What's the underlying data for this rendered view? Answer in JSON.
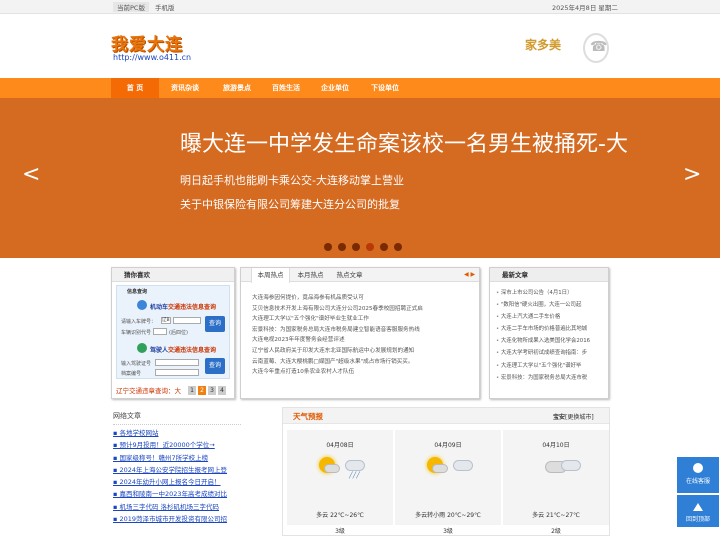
{
  "topbar": {
    "pc_label": "当前PC版",
    "mobile_label": "手机版",
    "date": "2025年4月8日 星期二"
  },
  "header": {
    "logo": "我爱大连",
    "url": "http://www.o411.cn",
    "brand": "家多美"
  },
  "nav": {
    "items": [
      "首 页",
      "资讯杂谈",
      "旅游景点",
      "百姓生活",
      "企业单位",
      "下设单位"
    ],
    "active_index": 0
  },
  "banner": {
    "headline": "曝大连一中学发生命案该校一名男生被捅死-大",
    "sub1": "明日起手机也能刷卡乘公交-大连移动掌上营业",
    "sub2": "关于中银保险有限公司筹建大连分公司的批复",
    "prev": "<",
    "next": ">",
    "dot_count": 6,
    "active_dot": 3
  },
  "traffic": {
    "title": "猜你喜欢",
    "info_label": "信息查询",
    "vehicle_title_a": "机动车",
    "vehicle_title_b": "交通违法信息查询",
    "plate_label": "请输入车牌号：",
    "plate_prefix": "辽B",
    "engine_label": "车辆识别代号",
    "engine_hint": "(后四位)",
    "query": "查询",
    "driver_title_a": "驾驶人",
    "driver_title_b": "交通违法信息查询",
    "license_label": "输入驾驶证号",
    "file_label": "档案编号",
    "footer_text": "辽宁交通违章查询：大",
    "pages": [
      "1",
      "2",
      "3",
      "4"
    ],
    "active_page": 1
  },
  "news": {
    "tabs": [
      "本周热点",
      "本月热点",
      "热点文章"
    ],
    "active_tab": 0,
    "arrows": "◀ ▶",
    "items": [
      "大连海参因何提价，竟品海参有机品质受认可",
      "艾贝信息技术开发上海有限公司大连分公司2025春季校园招聘正式启",
      "大连理工大学以\"五个强化\"谱好毕业生就业工作",
      "宏景科技：为国家税务总局大连市税务局建立智能语音客服服务热线",
      "大连电视2023年年度警务会经营评述",
      "辽宁省人民政府关于印发大连东北亚国际航运中心发展规划的通知",
      "云南蓝莓、大连大樱桃鹏□媒国产\"超级水果\"成占市场行销买买。",
      "大连今年重点打造10条农业农村人才队伍"
    ]
  },
  "latest": {
    "title": "最新文章",
    "items": [
      "深市上市公司公告（4月1日）",
      "\"数阳信\"硬火出圈，大连一公司起",
      "大连上汽大通二手车价格",
      "大连二手车市场的价格普遍比其地城",
      "大连化物所成果入选美国化学会2016",
      "大连大学考研初试成绩查询指南：步",
      "大连理工大学以\"五个强化\"谱好毕",
      "宏景科技：为国家税务总局大连市税"
    ]
  },
  "net": {
    "title": "网络文章",
    "items": [
      "各地学校网站",
      "预计9月投用！近20000个学位→",
      "国家级称号！赣州7所学校上榜",
      "2024年上海公安学院招生报考网上登",
      "2024年幼升小网上报名今日开启！",
      "嘉西和陵南一中2023年高考成绩对比",
      "机场三字代码 洛杉矶机场三字代码",
      "2019菏泽市城市开发投资有限公司招"
    ]
  },
  "weather": {
    "title": "天气预报",
    "city": "宝安",
    "change_city": "[更换城市]",
    "days": [
      {
        "date": "04月08日",
        "cond": "多云 22℃~26℃",
        "wind": "3级",
        "icons": "sun-cloud-rain"
      },
      {
        "date": "04月09日",
        "cond": "多云转小雨 20℃~29℃",
        "wind": "3级",
        "icons": "sun-cloud"
      },
      {
        "date": "04月10日",
        "cond": "多云 21℃~27℃",
        "wind": "2级",
        "icons": "cloud"
      }
    ]
  },
  "float": {
    "online_consult": "在线客服",
    "back_top": "回到顶部"
  }
}
